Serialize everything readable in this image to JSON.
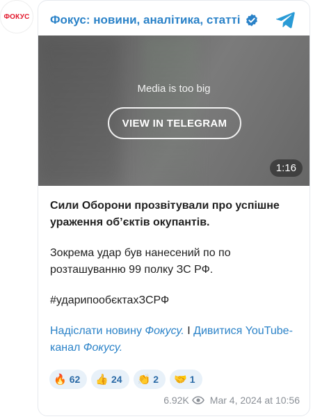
{
  "channel": {
    "avatar_text": "ФОКУС",
    "title": "Фокус: новини, аналітика, статті"
  },
  "media": {
    "message": "Media is too big",
    "button_label": "VIEW IN TELEGRAM",
    "duration": "1:16"
  },
  "post": {
    "lead": "Сили Оборони прозвітували про успішне ураження обʼєктів окупантів.",
    "paragraph": "Зокрема удар був нанесений по по розташуванню 99 полку ЗС РФ.",
    "hashtag": "#ударипообєктахЗСРФ",
    "link1_prefix": "Надіслати новину ",
    "link1_italic": "Фокусу.",
    "separator": " I ",
    "link2_prefix": "Дивитися YouTube-канал ",
    "link2_italic": "Фокусу."
  },
  "reactions": [
    {
      "emoji": "🔥",
      "icon_name": "fire-icon",
      "count": "62"
    },
    {
      "emoji": "👍",
      "icon_name": "thumbs-up-icon",
      "count": "24"
    },
    {
      "emoji": "👏",
      "icon_name": "clap-icon",
      "count": "2"
    },
    {
      "emoji": "🤝",
      "icon_name": "handshake-icon",
      "count": "1"
    }
  ],
  "meta": {
    "views": "6.92K",
    "date": "Mar 4, 2024 at 10:56"
  },
  "colors": {
    "accent": "#2a82c8",
    "brand_red": "#e2162a"
  }
}
